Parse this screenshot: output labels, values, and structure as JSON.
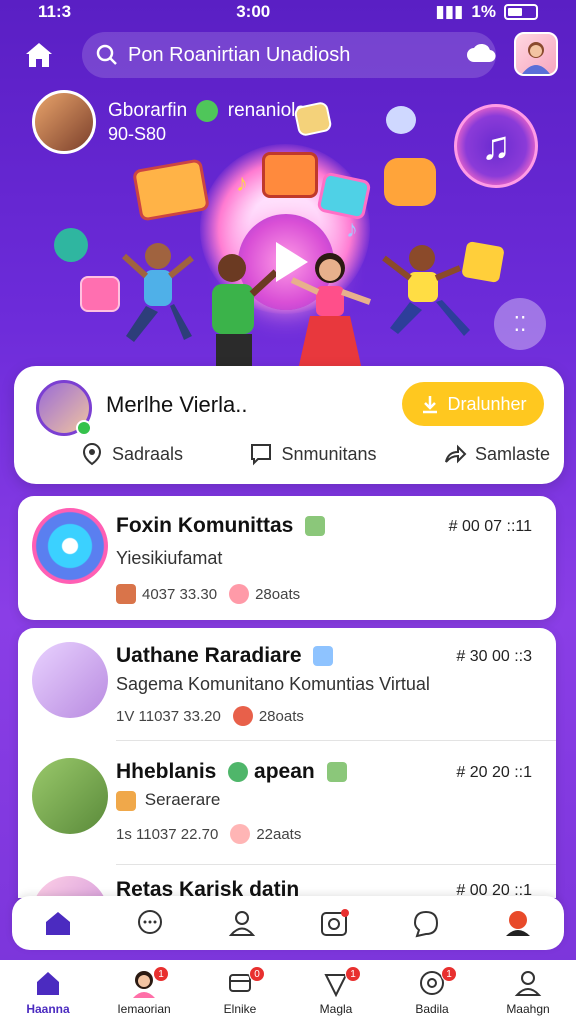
{
  "status_bar": {
    "time_left": "11:3",
    "time_center": "3:00",
    "battery": "1%"
  },
  "top_bar": {
    "search_text": "Pon Roanirtian Unadiosh"
  },
  "hero": {
    "user_name": "Gborarfin",
    "user_tag": "renaniolo",
    "user_sub": "90-S80"
  },
  "profile_card": {
    "name": "Merlhe Vierla..",
    "action_button": "Dralunher",
    "actions": [
      {
        "icon": "location-pin-icon",
        "label": "Sadraals"
      },
      {
        "icon": "chat-box-icon",
        "label": "Snmunitans"
      },
      {
        "icon": "share-arrow-icon",
        "label": "Samlaste"
      }
    ]
  },
  "feed": [
    {
      "title": "Foxin Komunittas",
      "time": "# 00 07 ::11",
      "subtitle": "Yiesikiufamat",
      "meta1": "4037 33.30",
      "meta2": "28oats"
    },
    {
      "title": "Uathane Raradiare",
      "time": "# 30 00 ::3",
      "subtitle": "Sagema Komunitano Komuntias Virtual",
      "meta1": "1V 11037 33.20",
      "meta2": "28oats"
    },
    {
      "title": "Hheblanis",
      "title_suffix": "apean",
      "time": "# 20 20 ::1",
      "subtitle": "Seraerare",
      "meta1": "1s 11037 22.70",
      "meta2": "22aats"
    },
    {
      "title": "Retas Karisk",
      "title_suffix": "datin",
      "time": "# 00 20 ::1"
    }
  ],
  "tab_bar": {
    "tabs": [
      {
        "label": "Haanna",
        "icon": "home-icon",
        "badge": ""
      },
      {
        "label": "Iemaorian",
        "icon": "avatar-icon",
        "badge": "1"
      },
      {
        "label": "Elnike",
        "icon": "layers-icon",
        "badge": "0"
      },
      {
        "label": "Magla",
        "icon": "shield-icon",
        "badge": "1"
      },
      {
        "label": "Badila",
        "icon": "target-icon",
        "badge": "1"
      },
      {
        "label": "Maahgn",
        "icon": "person-icon",
        "badge": ""
      }
    ]
  }
}
